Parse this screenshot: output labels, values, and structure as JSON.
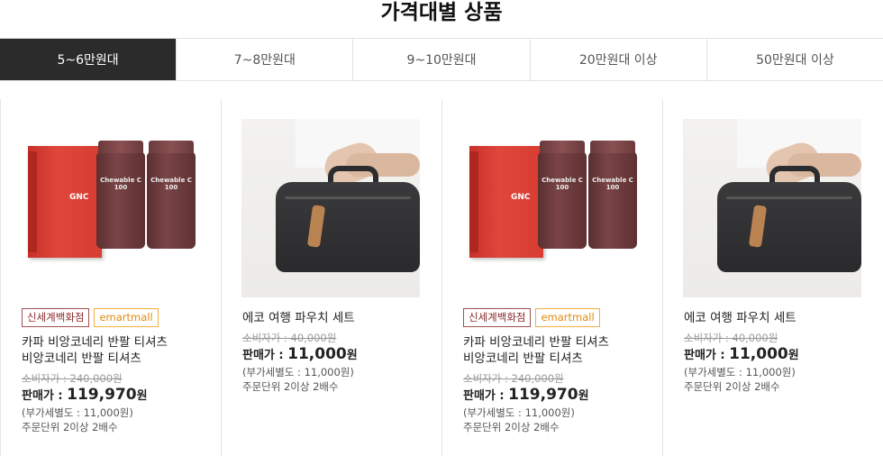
{
  "section_title": "가격대별 상품",
  "tabs": [
    {
      "label": "5~6만원대",
      "active": true
    },
    {
      "label": "7~8만원대",
      "active": false
    },
    {
      "label": "9~10만원대",
      "active": false
    },
    {
      "label": "20만원대 이상",
      "active": false
    },
    {
      "label": "50만원대 이상",
      "active": false
    }
  ],
  "products": [
    {
      "image": "gnc-chewable-c-gift-set",
      "image_text": {
        "brand": "GNC",
        "bottle_label": "Chewable C 100"
      },
      "badges": [
        "신세계백화점",
        "emartmall"
      ],
      "name": "카파 비앙코네리 반팔 티셔츠 비앙코네리 반팔 티셔츠",
      "orig_price": "소비자가 : 240,000원",
      "sale_label": "판매가 : ",
      "sale_price": "119,970",
      "sale_unit": "원",
      "vat": "(부가세별도 : 11,000원)",
      "order_unit": "주문단위 2이상 2배수"
    },
    {
      "image": "black-travel-pouch",
      "badges": [],
      "name": "에코 여행 파우치 세트",
      "orig_price": "소비자가 : 40,000원",
      "sale_label": "판매가 : ",
      "sale_price": "11,000",
      "sale_unit": "원",
      "vat": "(부가세별도 : 11,000원)",
      "order_unit": "주문단위 2이상 2배수"
    },
    {
      "image": "gnc-chewable-c-gift-set",
      "image_text": {
        "brand": "GNC",
        "bottle_label": "Chewable C 100"
      },
      "badges": [
        "신세계백화점",
        "emartmall"
      ],
      "name": "카파 비앙코네리 반팔 티셔츠 비앙코네리 반팔 티셔츠",
      "orig_price": "소비자가 : 240,000원",
      "sale_label": "판매가 : ",
      "sale_price": "119,970",
      "sale_unit": "원",
      "vat": "(부가세별도 : 11,000원)",
      "order_unit": "주문단위 2이상 2배수"
    },
    {
      "image": "black-travel-pouch",
      "badges": [],
      "name": "에코 여행 파우치 세트",
      "orig_price": "소비자가 : 40,000원",
      "sale_label": "판매가 : ",
      "sale_price": "11,000",
      "sale_unit": "원",
      "vat": "(부가세별도 : 11,000원)",
      "order_unit": "주문단위 2이상 2배수"
    }
  ],
  "colors": {
    "active_tab_bg": "#2b2b2b",
    "shinsegae_badge": "#8b2a2a",
    "emart_badge": "#e08a10"
  }
}
